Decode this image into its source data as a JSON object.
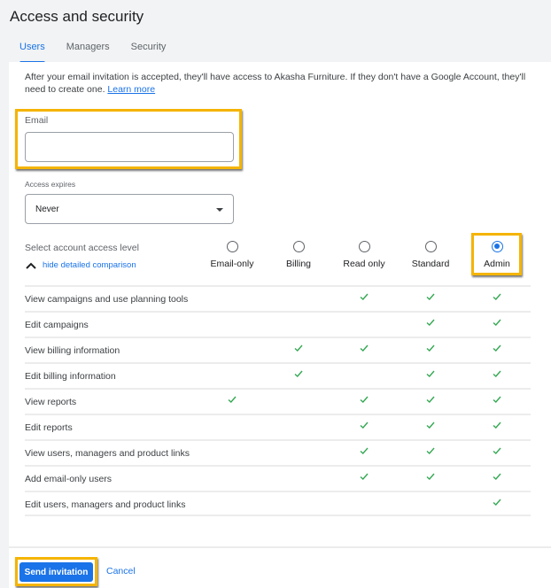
{
  "header": {
    "title": "Access and security"
  },
  "tabs": [
    {
      "label": "Users",
      "active": true
    },
    {
      "label": "Managers",
      "active": false
    },
    {
      "label": "Security",
      "active": false
    }
  ],
  "intro": {
    "text": "After your email invitation is accepted, they'll have access to Akasha Furniture. If they don't have a Google Account, they'll need to create one. ",
    "link": "Learn more"
  },
  "email": {
    "label": "Email",
    "value": "",
    "placeholder": ""
  },
  "access_expires": {
    "label": "Access expires",
    "selected": "Never"
  },
  "access_level": {
    "label": "Select account access level",
    "toggle_label": "hide detailed comparison",
    "roles": [
      {
        "label": "Email-only",
        "checked": false
      },
      {
        "label": "Billing",
        "checked": false
      },
      {
        "label": "Read only",
        "checked": false
      },
      {
        "label": "Standard",
        "checked": false
      },
      {
        "label": "Admin",
        "checked": true
      }
    ]
  },
  "permissions": [
    {
      "name": "View campaigns and use planning tools",
      "roles": [
        false,
        false,
        true,
        true,
        true
      ]
    },
    {
      "name": "Edit campaigns",
      "roles": [
        false,
        false,
        false,
        true,
        true
      ]
    },
    {
      "name": "View billing information",
      "roles": [
        false,
        true,
        true,
        true,
        true
      ]
    },
    {
      "name": "Edit billing information",
      "roles": [
        false,
        true,
        false,
        true,
        true
      ]
    },
    {
      "name": "View reports",
      "roles": [
        true,
        false,
        true,
        true,
        true
      ]
    },
    {
      "name": "Edit reports",
      "roles": [
        false,
        false,
        true,
        true,
        true
      ]
    },
    {
      "name": "View users, managers and product links",
      "roles": [
        false,
        false,
        true,
        true,
        true
      ]
    },
    {
      "name": "Add email-only users",
      "roles": [
        false,
        false,
        true,
        true,
        true
      ]
    },
    {
      "name": "Edit users, managers and product links",
      "roles": [
        false,
        false,
        false,
        false,
        true
      ]
    }
  ],
  "footer": {
    "send_label": "Send invitation",
    "cancel_label": "Cancel"
  },
  "colors": {
    "accent": "#1a73e8",
    "check": "#34a853",
    "highlight": "#f5b400"
  }
}
